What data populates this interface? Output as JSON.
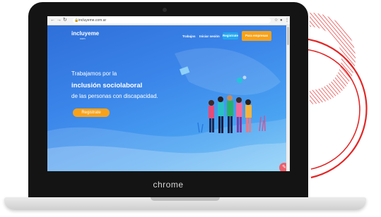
{
  "browser": {
    "url": "incluyeme.com.ar",
    "nav_icons": [
      "back-icon",
      "forward-icon",
      "reload-icon"
    ],
    "actions": [
      "star-icon",
      "profile-icon",
      "menu-icon"
    ]
  },
  "site": {
    "logo_text": "incluyeme",
    "logo_sub": "com",
    "nav": {
      "trabajos": "Trabajos",
      "iniciar_sesion": "Iniciar sesión",
      "registrate": "Registrate",
      "para_empresas": "Para empresas"
    },
    "hero": {
      "line1": "Trabajamos por la",
      "line2": "inclusión sociolaboral",
      "line3": "de las personas con discapacidad.",
      "cta": "Registrate"
    },
    "chat_icon": "chat-icon"
  },
  "laptop": {
    "brand": "chrome"
  },
  "colors": {
    "accent_orange": "#f8a21a",
    "accent_blue": "#22a8f0",
    "deco_red": "#e32626",
    "chat_red": "#ee5f6b"
  }
}
